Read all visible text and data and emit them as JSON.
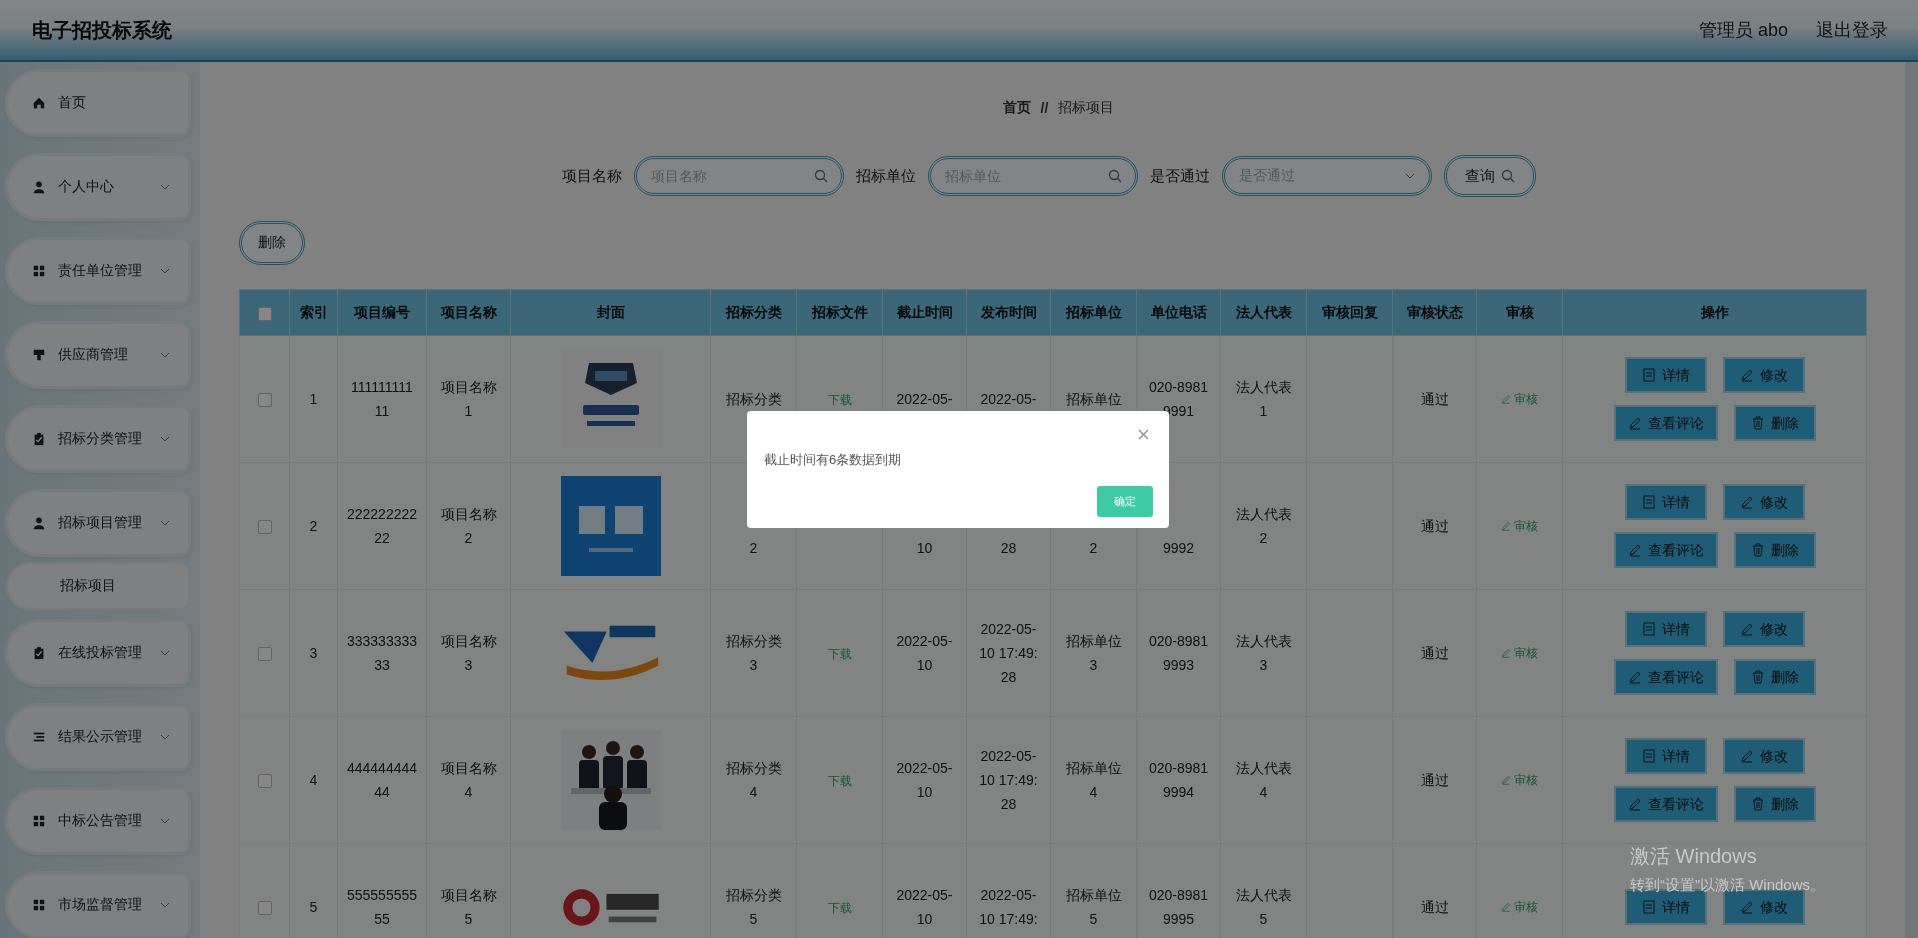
{
  "header": {
    "title": "电子招投标系统",
    "user": "管理员 abo",
    "logout": "退出登录"
  },
  "sidebar": {
    "items": [
      {
        "label": "首页",
        "kind": "link"
      },
      {
        "label": "个人中心",
        "kind": "menu"
      },
      {
        "label": "责任单位管理",
        "kind": "menu"
      },
      {
        "label": "供应商管理",
        "kind": "menu"
      },
      {
        "label": "招标分类管理",
        "kind": "menu"
      },
      {
        "label": "招标项目管理",
        "kind": "menu",
        "children": [
          {
            "label": "招标项目"
          }
        ]
      },
      {
        "label": "在线投标管理",
        "kind": "menu"
      },
      {
        "label": "结果公示管理",
        "kind": "menu"
      },
      {
        "label": "中标公告管理",
        "kind": "menu"
      },
      {
        "label": "市场监督管理",
        "kind": "menu"
      }
    ]
  },
  "breadcrumb": {
    "items": [
      "首页",
      "招标项目"
    ],
    "separator": "//"
  },
  "search": {
    "fields": [
      {
        "label": "项目名称",
        "placeholder": "项目名称",
        "kind": "text"
      },
      {
        "label": "招标单位",
        "placeholder": "招标单位",
        "kind": "text"
      },
      {
        "label": "是否通过",
        "placeholder": "是否通过",
        "kind": "select"
      }
    ],
    "button": "查询"
  },
  "toolbar": {
    "delete": "删除"
  },
  "table": {
    "all_selected": false,
    "columns": [
      "索引",
      "项目编号",
      "项目名称",
      "封面",
      "招标分类",
      "招标文件",
      "截止时间",
      "发布时间",
      "招标单位",
      "单位电话",
      "法人代表",
      "审核回复",
      "审核状态",
      "审核",
      "操作"
    ],
    "rows": [
      {
        "selected": false,
        "index": "1",
        "code": "111111111\n11",
        "name": "项目名称\n1",
        "category": "招标分类",
        "file": "下载",
        "deadline": "2022-05-",
        "publish": "2022-05-",
        "unit": "招标单位",
        "phone": "020-8981\n9991",
        "legal": "法人代表\n1",
        "status": "通过",
        "review": "审核",
        "actions": [
          "详情",
          "修改",
          "查看评论",
          "删除"
        ]
      },
      {
        "selected": false,
        "index": "2",
        "code": "222222222\n22",
        "name": "项目名称\n2",
        "category": "2",
        "deadline": "10",
        "publish": "28",
        "unit": "2",
        "phone": "9992",
        "legal": "法人代表\n2",
        "status": "通过",
        "review": "审核",
        "actions": [
          "详情",
          "修改",
          "查看评论",
          "删除"
        ]
      },
      {
        "selected": false,
        "index": "3",
        "code": "333333333\n33",
        "name": "项目名称\n3",
        "category": "招标分类\n3",
        "file": "下载",
        "deadline": "2022-05-\n10",
        "publish": "2022-05-\n10 17:49:\n28",
        "unit": "招标单位\n3",
        "phone": "020-8981\n9993",
        "legal": "法人代表\n3",
        "status": "通过",
        "review": "审核",
        "actions": [
          "详情",
          "修改",
          "查看评论",
          "删除"
        ]
      },
      {
        "selected": false,
        "index": "4",
        "code": "444444444\n44",
        "name": "项目名称\n4",
        "category": "招标分类\n4",
        "file": "下载",
        "deadline": "2022-05-\n10",
        "publish": "2022-05-\n10 17:49:\n28",
        "unit": "招标单位\n4",
        "phone": "020-8981\n9994",
        "legal": "法人代表\n4",
        "status": "通过",
        "review": "审核",
        "actions": [
          "详情",
          "修改",
          "查看评论",
          "删除"
        ]
      },
      {
        "selected": false,
        "index": "5",
        "code": "555555555\n55",
        "name": "项目名称\n5",
        "category": "招标分类\n5",
        "file": "下载",
        "deadline": "2022-05-\n10",
        "publish": "2022-05-\n10 17:49:",
        "unit": "招标单位\n5",
        "phone": "020-8981\n9995",
        "legal": "法人代表\n5",
        "status": "通过",
        "review": "审核",
        "actions": [
          "详情",
          "修改"
        ]
      }
    ]
  },
  "dialog": {
    "message": "截止时间有6条数据到期",
    "button": "确定"
  },
  "os_notice": {
    "title": "激活 Windows",
    "hint": "转到“设置”以激活 Windows。"
  }
}
